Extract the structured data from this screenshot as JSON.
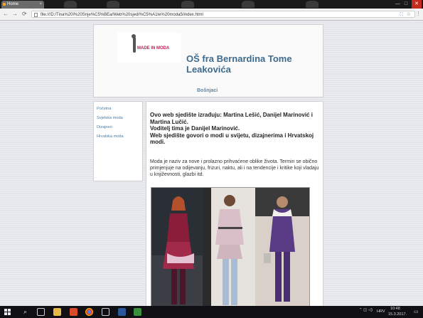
{
  "browser": {
    "tab_title": "Home",
    "tab_close": "×",
    "window_buttons": [
      "—",
      "□",
      "✕"
    ],
    "address": "file:///D:/Tina%20i%20Snje%C5%BEa/Web%20sjedi%C5%A1te%20moda5/index.html",
    "nav": {
      "back": "←",
      "forward": "→",
      "reload": "⟳"
    },
    "icons": [
      "file-icon",
      "translate-icon",
      "star-icon",
      "menu-icon"
    ]
  },
  "site": {
    "logo_text": "MADE IN MODA",
    "title": "OŠ fra Bernardina Tome Leakovića",
    "lang_link": "Bošnjaci"
  },
  "sidebar": {
    "items": [
      {
        "label": "Početna"
      },
      {
        "label": "Svjetska moda"
      },
      {
        "label": "Dizajneri"
      },
      {
        "label": "Hrvatska moda"
      }
    ]
  },
  "content": {
    "intro_lines": [
      "Ovo web sjedište izrađuju: Martina Lešić, Danijel Marinović i Martina Lučić.",
      "Voditelj tima je Danijel Marinović.",
      "Web sjedište govori o modi u svijetu, dizajnerima i Hrvatskoj modi."
    ],
    "description": "Moda je naziv za nove i prolazno prihvaćene oblike života. Termin se obično primjenjuje na odijevanju, frizuri, naktu, ali i na tendencije i kritike koji vladaju u književnosti, glazbi itd."
  },
  "taskbar": {
    "apps": [
      "start-icon",
      "search-icon",
      "task-view-icon",
      "file-explorer-icon",
      "edge-icon",
      "chrome-icon",
      "store-icon",
      "word-icon",
      "image-viewer-icon"
    ],
    "lang": "HRV",
    "time": "10:48",
    "date": "15.3.2017."
  },
  "colors": {
    "title": "#3e6b8d",
    "sidebar_link": "#4a7ba0",
    "lang_link": "#5b88b1",
    "logo": "#c21d5a"
  }
}
